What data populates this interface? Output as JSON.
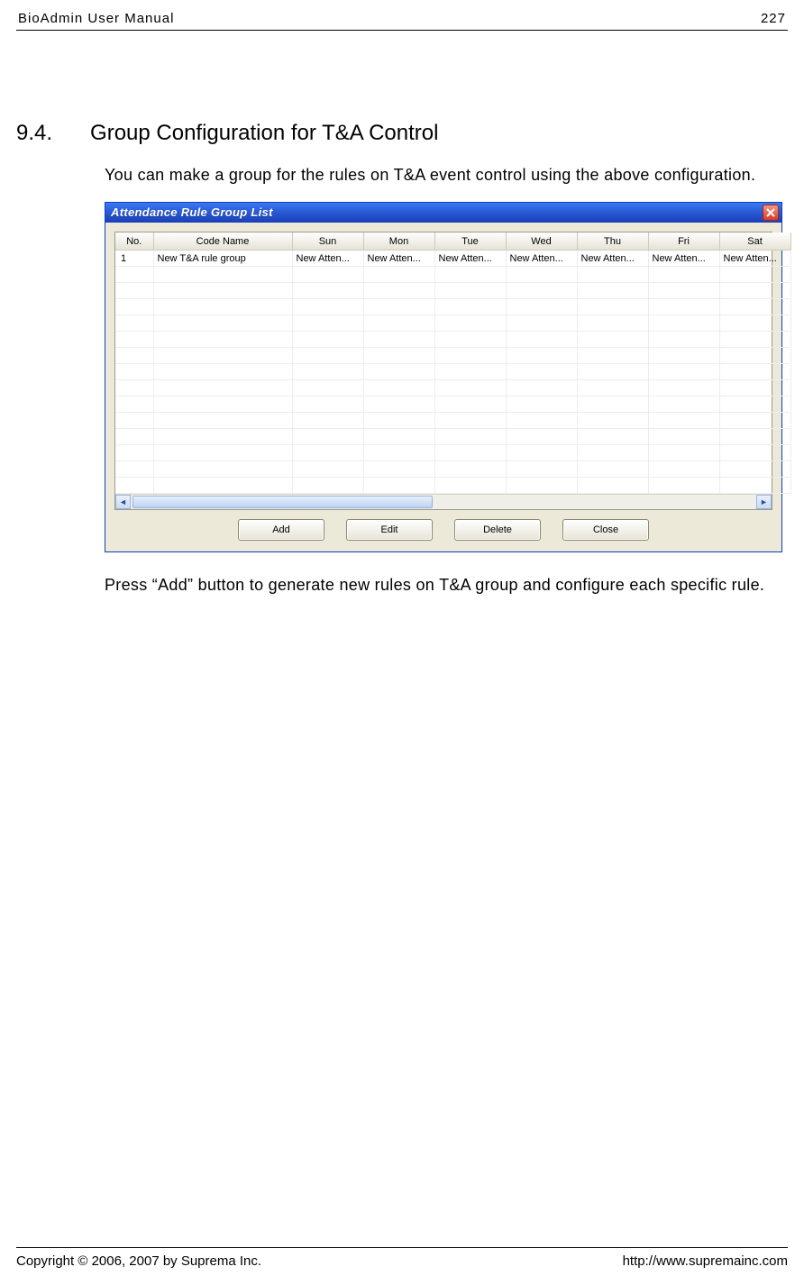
{
  "header": {
    "left": "BioAdmin User Manual",
    "right": "227"
  },
  "section": {
    "number": "9.4.",
    "title": "Group Configuration for T&A Control"
  },
  "para1": "You can make a group for the rules on T&A event control using the above configuration.",
  "para2": "Press “Add” button to generate new rules on T&A group and configure each specific rule.",
  "dialog": {
    "title": "Attendance Rule Group List",
    "columns": [
      "No.",
      "Code Name",
      "Sun",
      "Mon",
      "Tue",
      "Wed",
      "Thu",
      "Fri",
      "Sat"
    ],
    "rows": [
      {
        "no": "1",
        "name": "New T&A rule group",
        "days": [
          "New Atten...",
          "New Atten...",
          "New Atten...",
          "New Atten...",
          "New Atten...",
          "New Atten...",
          "New Atten..."
        ]
      }
    ],
    "blank_rows": 14,
    "buttons": {
      "add": "Add",
      "edit": "Edit",
      "delete": "Delete",
      "close": "Close"
    }
  },
  "footer": {
    "left": "Copyright © 2006, 2007 by Suprema Inc.",
    "right": "http://www.supremainc.com"
  }
}
